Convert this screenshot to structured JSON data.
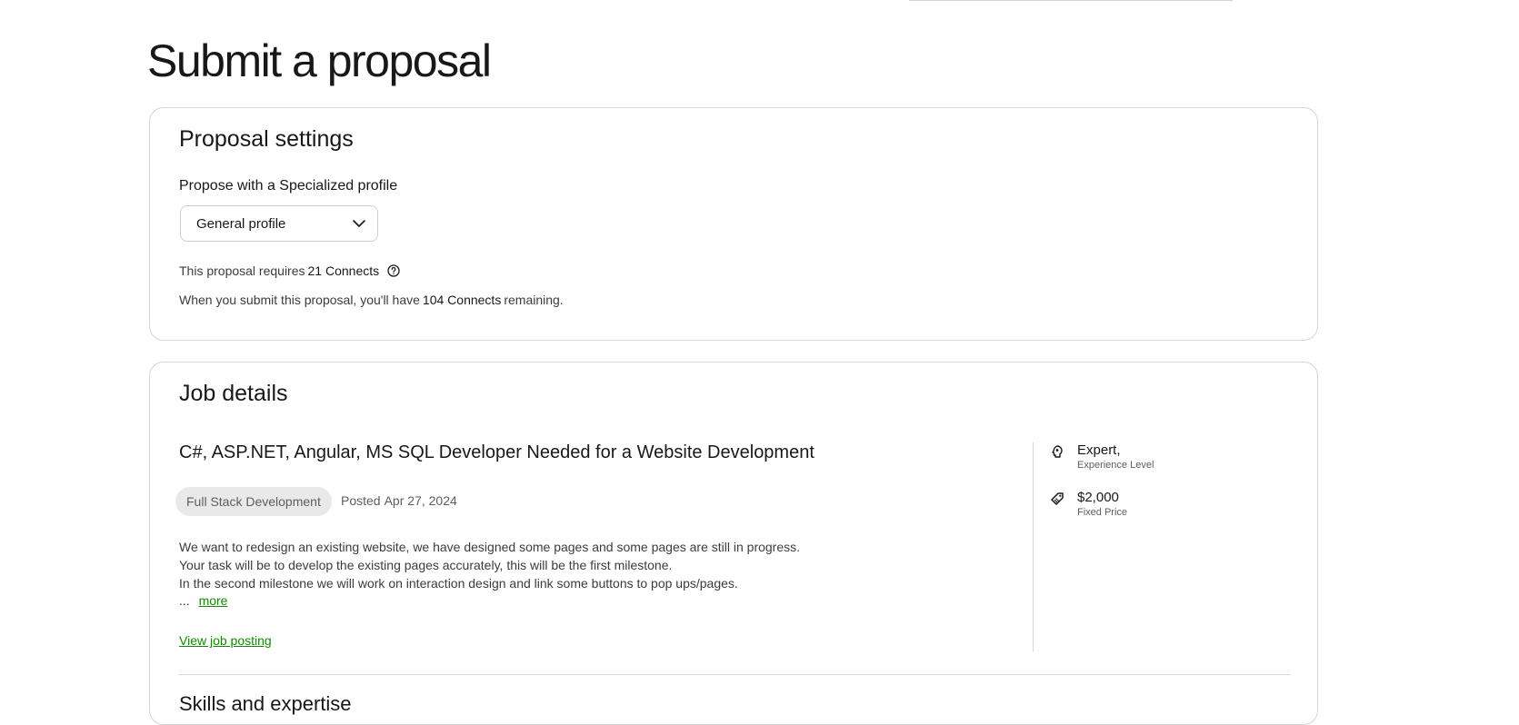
{
  "page": {
    "title": "Submit a proposal"
  },
  "proposal_settings": {
    "title": "Proposal settings",
    "profile_label": "Propose with a Specialized profile",
    "profile_selected": "General profile",
    "requires_prefix": "This proposal requires",
    "requires_value": "21 Connects",
    "remaining_prefix": "When you submit this proposal, you'll have",
    "remaining_value": "104 Connects",
    "remaining_suffix": "remaining."
  },
  "job_details": {
    "title": "Job details",
    "job_title": "C#, ASP.NET, Angular, MS SQL Developer Needed for a Website Development",
    "category": "Full Stack Development",
    "posted_label": "Posted",
    "posted_date": "Apr 27, 2024",
    "description_lines": [
      "We want to redesign an existing website, we have designed some pages and some pages are still in progress.",
      "Your task will be to develop the existing pages accurately, this will be the first milestone.",
      "In the second milestone we will work on interaction design and link some buttons to pop ups/pages."
    ],
    "ellipsis": "...",
    "more_label": "more",
    "view_posting_label": "View job posting",
    "experience_value": "Expert,",
    "experience_label": "Experience Level",
    "price_value": "$2,000",
    "price_label": "Fixed Price"
  },
  "skills": {
    "title": "Skills and expertise"
  },
  "icons": {
    "chevron": "chevron-down-icon",
    "help": "question-circle-icon",
    "experience": "brain-icon",
    "price": "tag-icon"
  },
  "colors": {
    "link": "#108a00",
    "text": "#181818",
    "muted": "#5e5e5e",
    "border": "#d5d5d5",
    "pill": "#e9e9e9"
  }
}
